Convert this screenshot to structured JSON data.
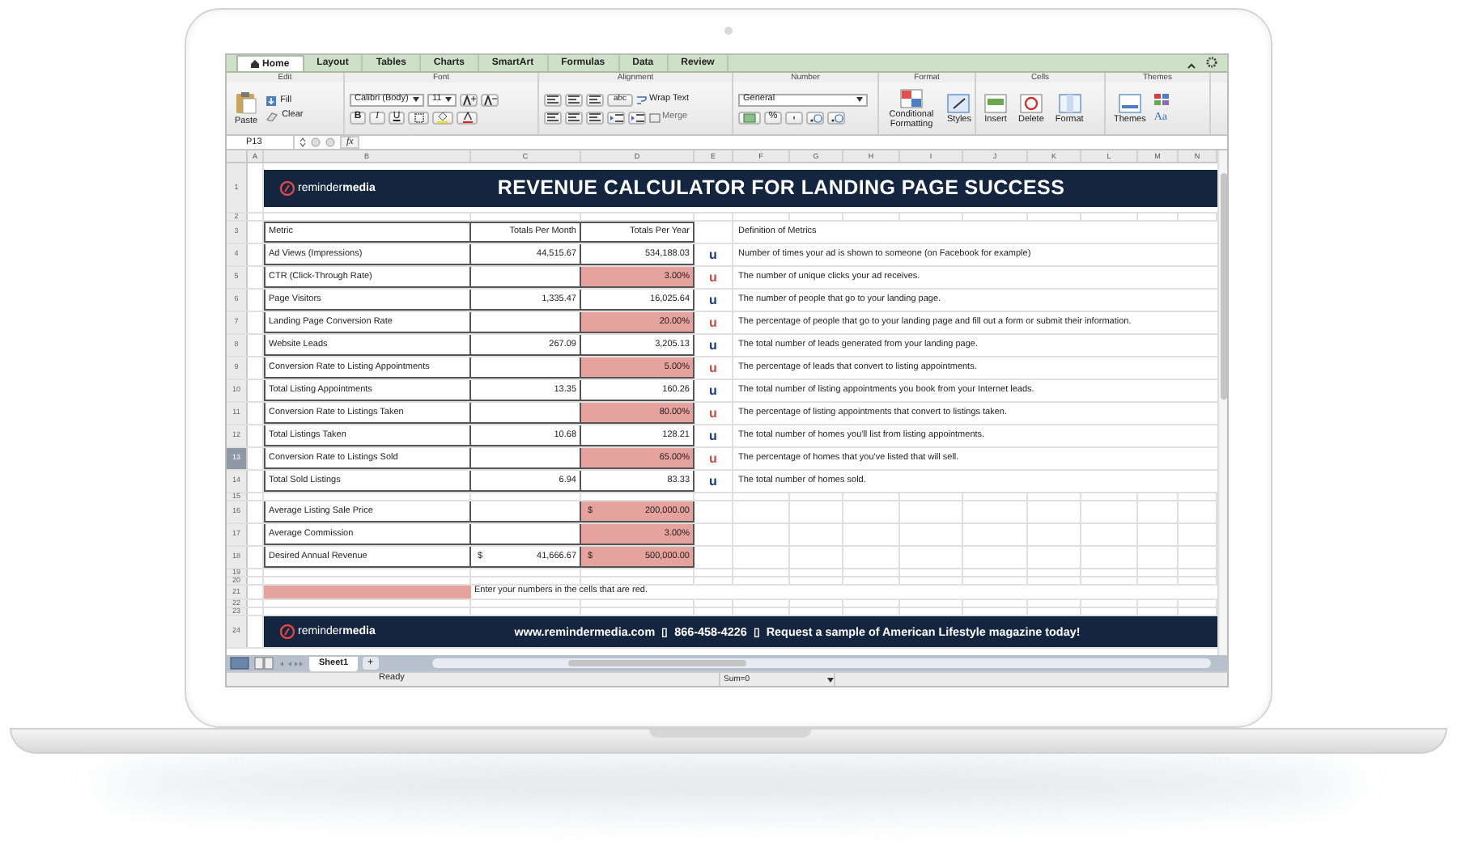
{
  "ribbon": {
    "tabs": [
      {
        "label": "Home",
        "selected": true
      },
      {
        "label": "Layout",
        "selected": false
      },
      {
        "label": "Tables",
        "selected": false
      },
      {
        "label": "Charts",
        "selected": false
      },
      {
        "label": "SmartArt",
        "selected": false
      },
      {
        "label": "Formulas",
        "selected": false
      },
      {
        "label": "Data",
        "selected": false
      },
      {
        "label": "Review",
        "selected": false
      }
    ],
    "groups": [
      {
        "kind": "edit",
        "label": "Edit",
        "paste": "Paste",
        "fill": "Fill",
        "clear": "Clear"
      },
      {
        "kind": "font",
        "label": "Font",
        "font": "Calibri (Body)",
        "size": "11",
        "bold": "B",
        "italic": "I",
        "underline": "U"
      },
      {
        "kind": "alignment",
        "label": "Alignment",
        "abc": "abc",
        "wrap": "Wrap Text",
        "merge": "Merge",
        "merge_disabled": true
      },
      {
        "kind": "number",
        "label": "Number",
        "format": "General",
        "percent": "%",
        "comma": ","
      },
      {
        "kind": "format",
        "label": "Format",
        "conditional": "Conditional Formatting",
        "styles": "Styles"
      },
      {
        "kind": "cells",
        "label": "Cells",
        "insert": "Insert",
        "delete": "Delete",
        "format": "Format"
      },
      {
        "kind": "themes",
        "label": "Themes",
        "themes": "Themes",
        "fonts": "Aa"
      }
    ]
  },
  "formula_bar": {
    "cell": "P13",
    "fx": "fx"
  },
  "columns": [
    "A",
    "B",
    "C",
    "D",
    "E",
    "F",
    "G",
    "H",
    "I",
    "J",
    "K",
    "L",
    "M",
    "N"
  ],
  "rows": [
    {
      "n": "1",
      "selected": false,
      "kind": "banner",
      "logo": "reminder**media**",
      "title": "REVENUE CALCULATOR FOR LANDING PAGE SUCCESS"
    },
    {
      "n": "2",
      "selected": false,
      "kind": "blank"
    },
    {
      "n": "3",
      "selected": false,
      "kind": "header",
      "metric": "Metric",
      "per_month": "Totals Per Month",
      "per_year": "Totals Per Year",
      "definition": "Definition of Metrics"
    },
    {
      "n": "4",
      "selected": false,
      "kind": "metric",
      "metric": "Ad Views (Impressions)",
      "per_month": "44,515.67",
      "per_year": "534,188.03",
      "input": false,
      "marker": {
        "text": "u",
        "color": "#1f3864"
      },
      "definition": "Number of times your ad is shown to someone (on Facebook for example)"
    },
    {
      "n": "5",
      "selected": false,
      "kind": "metric",
      "metric": "CTR (Click-Through Rate)",
      "per_year": "3.00%",
      "input": true,
      "marker": {
        "text": "u",
        "color": "#c0504d"
      },
      "definition": "The number of unique clicks your ad receives."
    },
    {
      "n": "6",
      "selected": false,
      "kind": "metric",
      "metric": "Page Visitors",
      "per_month": "1,335.47",
      "per_year": "16,025.64",
      "input": false,
      "marker": {
        "text": "u",
        "color": "#1f3864"
      },
      "definition": "The number of people that go to your landing page."
    },
    {
      "n": "7",
      "selected": false,
      "kind": "metric",
      "metric": "Landing Page Conversion Rate",
      "per_year": "20.00%",
      "input": true,
      "marker": {
        "text": "u",
        "color": "#c0504d"
      },
      "definition": "The percentage of people that go to your landing page and fill out a form or submit their information."
    },
    {
      "n": "8",
      "selected": false,
      "kind": "metric",
      "metric": "Website Leads",
      "per_month": "267.09",
      "per_year": "3,205.13",
      "input": false,
      "marker": {
        "text": "u",
        "color": "#1f3864"
      },
      "definition": "The total number of leads generated from your landing page."
    },
    {
      "n": "9",
      "selected": false,
      "kind": "metric",
      "metric": "Conversion Rate to Listing Appointments",
      "per_year": "5.00%",
      "input": true,
      "marker": {
        "text": "u",
        "color": "#c0504d"
      },
      "definition": "The percentage of leads that convert to listing appointments."
    },
    {
      "n": "10",
      "selected": false,
      "kind": "metric",
      "metric": "Total Listing Appointments",
      "per_month": "13.35",
      "per_year": "160.26",
      "input": false,
      "marker": {
        "text": "u",
        "color": "#1f3864"
      },
      "definition": "The total number of listing appointments you book from your Internet leads."
    },
    {
      "n": "11",
      "selected": false,
      "kind": "metric",
      "metric": "Conversion Rate to Listings Taken",
      "per_year": "80.00%",
      "input": true,
      "marker": {
        "text": "u",
        "color": "#c0504d"
      },
      "definition": "The percentage of listing appointments that convert to listings taken."
    },
    {
      "n": "12",
      "selected": false,
      "kind": "metric",
      "metric": "Total Listings Taken",
      "per_month": "10.68",
      "per_year": "128.21",
      "input": false,
      "marker": {
        "text": "u",
        "color": "#1f3864"
      },
      "definition": "The total number of homes you'll list from listing appointments."
    },
    {
      "n": "13",
      "selected": true,
      "kind": "metric",
      "metric": "Conversion Rate to Listings Sold",
      "per_year": "65.00%",
      "input": true,
      "marker": {
        "text": "u",
        "color": "#c0504d"
      },
      "definition": "The percentage of homes that you've listed that will sell."
    },
    {
      "n": "14",
      "selected": false,
      "kind": "metric",
      "metric": "Total Sold Listings",
      "per_month": "6.94",
      "per_year": "83.33",
      "input": false,
      "marker": {
        "text": "u",
        "color": "#1f3864"
      },
      "definition": "The total number of homes sold."
    },
    {
      "n": "15",
      "selected": false,
      "kind": "blank"
    },
    {
      "n": "16",
      "selected": false,
      "kind": "metric",
      "metric": "Average Listing Sale Price",
      "per_year": "200,000.00",
      "currency_year": "$",
      "input": true
    },
    {
      "n": "17",
      "selected": false,
      "kind": "metric",
      "metric": "Average Commission",
      "per_year": "3.00%",
      "input": true
    },
    {
      "n": "18",
      "selected": false,
      "kind": "metric",
      "metric": "Desired Annual Revenue",
      "per_month": "41,666.67",
      "currency_month": "$",
      "per_year": "500,000.00",
      "currency_year": "$",
      "input": true
    },
    {
      "n": "19",
      "selected": false,
      "kind": "blank"
    },
    {
      "n": "20",
      "selected": false,
      "kind": "blank"
    },
    {
      "n": "21",
      "selected": false,
      "kind": "note",
      "swatch": true,
      "note": "Enter your numbers in the cells that are red."
    },
    {
      "n": "22",
      "selected": false,
      "kind": "blank"
    },
    {
      "n": "23",
      "selected": false,
      "kind": "blank"
    },
    {
      "n": "24",
      "selected": false,
      "kind": "footer",
      "logo": "reminder**media**",
      "website": "www.remindermedia.com",
      "separator_1": "▯",
      "phone": "866-458-4226",
      "separator_2": "▯",
      "request": "Request a sample of American Lifestyle magazine today!"
    }
  ],
  "sheet_tabs": [
    {
      "label": "Sheet1",
      "selected": true
    }
  ],
  "add_sheet": "+",
  "status_bar": {
    "mode": "Ready",
    "sum": "Sum=0"
  }
}
